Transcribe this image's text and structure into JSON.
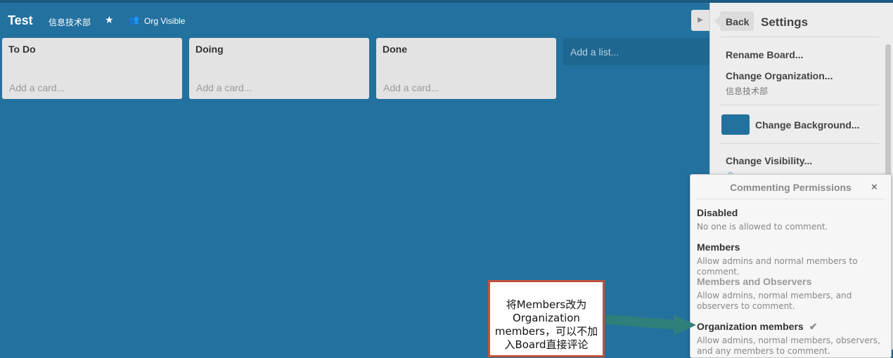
{
  "board": {
    "title": "Test",
    "org": "信息技术部",
    "star_icon": "star-icon",
    "visibility_icon": "people-icon",
    "visibility": "Org Visible"
  },
  "lists": [
    {
      "name": "To Do",
      "add_card": "Add a card..."
    },
    {
      "name": "Doing",
      "add_card": "Add a card..."
    },
    {
      "name": "Done",
      "add_card": "Add a card..."
    }
  ],
  "add_list": "Add a list...",
  "sidebar": {
    "back": "Back",
    "title": "Settings",
    "rename": "Rename Board...",
    "change_org": "Change Organization...",
    "org_name": "信息技术部",
    "change_background": "Change Background...",
    "change_visibility": "Change Visibility..."
  },
  "popover": {
    "title": "Commenting Permissions",
    "close": "×",
    "options": [
      {
        "name": "Disabled",
        "desc": "No one is allowed to comment."
      },
      {
        "name": "Members",
        "desc": "Allow admins and normal members to comment."
      },
      {
        "name": "Members and Observers",
        "desc": "Allow admins, normal members, and observers to comment."
      },
      {
        "name": "Organization members",
        "desc": "Allow admins, normal members, observers, and any members to comment."
      }
    ],
    "checkmark": "✔"
  },
  "callout": {
    "text": "将Members改为Organization members，可以不加入Board直接评论"
  },
  "colors": {
    "board_bg": "#23719f",
    "callout_border": "#c0533a",
    "arrow": "#2f7f7a"
  }
}
